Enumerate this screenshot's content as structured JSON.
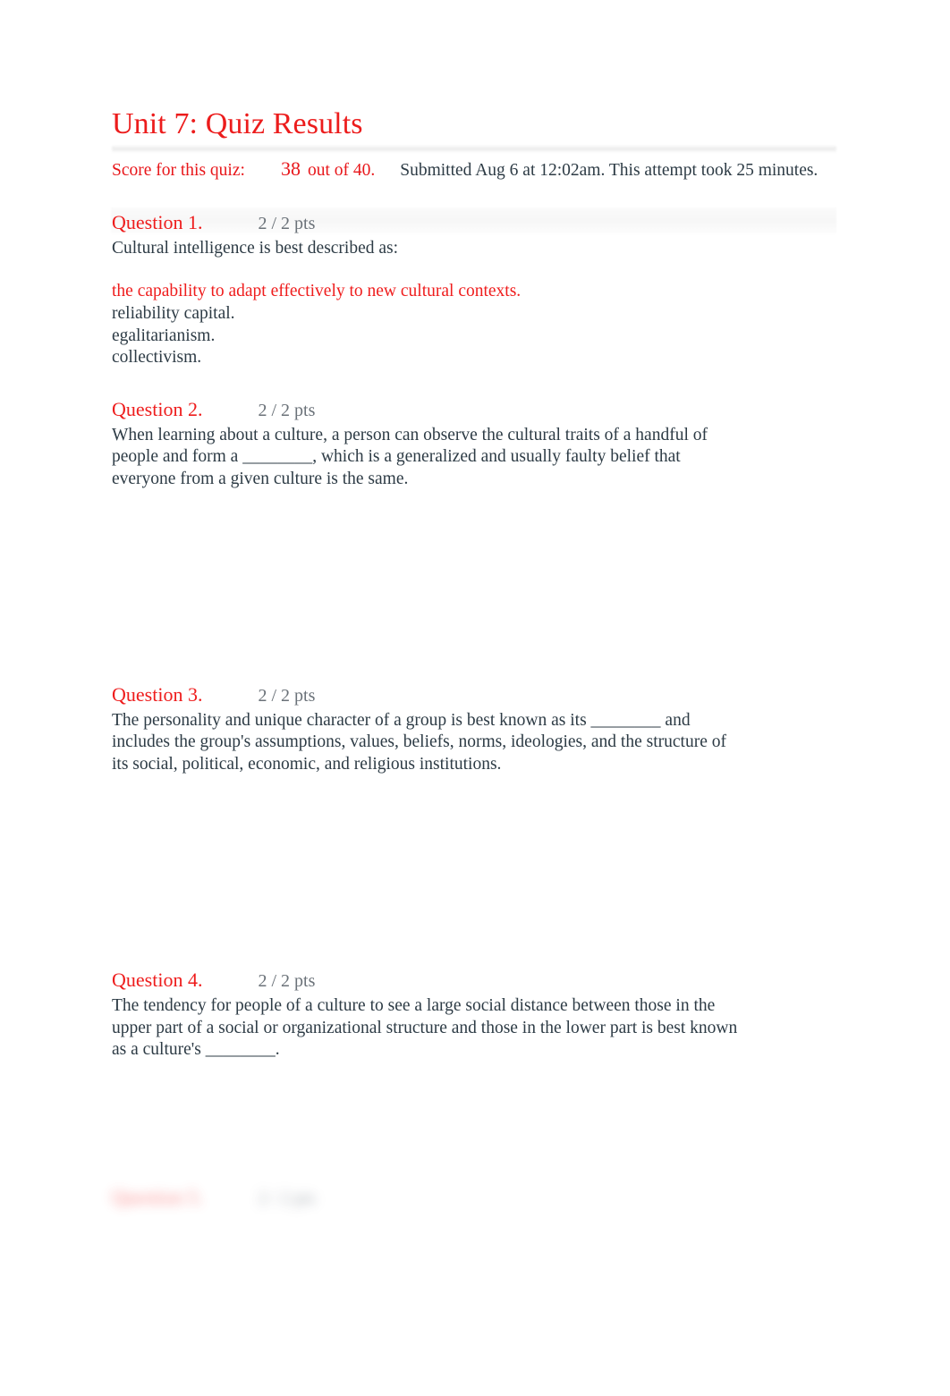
{
  "document": {
    "title": "Unit 7: Quiz Results"
  },
  "score": {
    "label": "Score for this quiz:",
    "value": "38",
    "out_of": "out of 40.",
    "submitted": "Submitted Aug 6 at 12:02am. This attempt took 25 minutes."
  },
  "colors": {
    "accent_red": "#ec1c1c",
    "body_text": "#2d3b45",
    "points_gray": "#6b7279",
    "band_gray": "#f6f6f6"
  },
  "questions": [
    {
      "label": "Question 1.",
      "points": "2 / 2 pts",
      "text": "Cultural intelligence is best described as:",
      "answers": [
        {
          "text": "the capability to adapt effectively to new cultural contexts.",
          "selected": true
        },
        {
          "text": "reliability capital.",
          "selected": false
        },
        {
          "text": "egalitarianism.",
          "selected": false
        },
        {
          "text": "collectivism.",
          "selected": false
        }
      ]
    },
    {
      "label": "Question 2.",
      "points": "2 / 2 pts",
      "text": "When learning about a culture, a person can observe the cultural traits of a handful of people and form a ________, which is a generalized and usually faulty belief that everyone from a given culture is the same.",
      "answers": []
    },
    {
      "label": "Question 3.",
      "points": "2 / 2 pts",
      "text": "The personality and unique character of a group is best known as its ________ and includes the group's assumptions, values, beliefs, norms, ideologies, and the structure of its social, political, economic, and religious institutions.",
      "answers": []
    },
    {
      "label": "Question 4.",
      "points": "2 / 2 pts",
      "text": "The tendency for people of a culture to see a large social distance between those in the upper part of a social or organizational structure and those in the lower part is best known as a culture's ________.",
      "answers": []
    }
  ],
  "cutoff_question": {
    "label": "Question 5.",
    "points": "2 / 2 pts"
  }
}
